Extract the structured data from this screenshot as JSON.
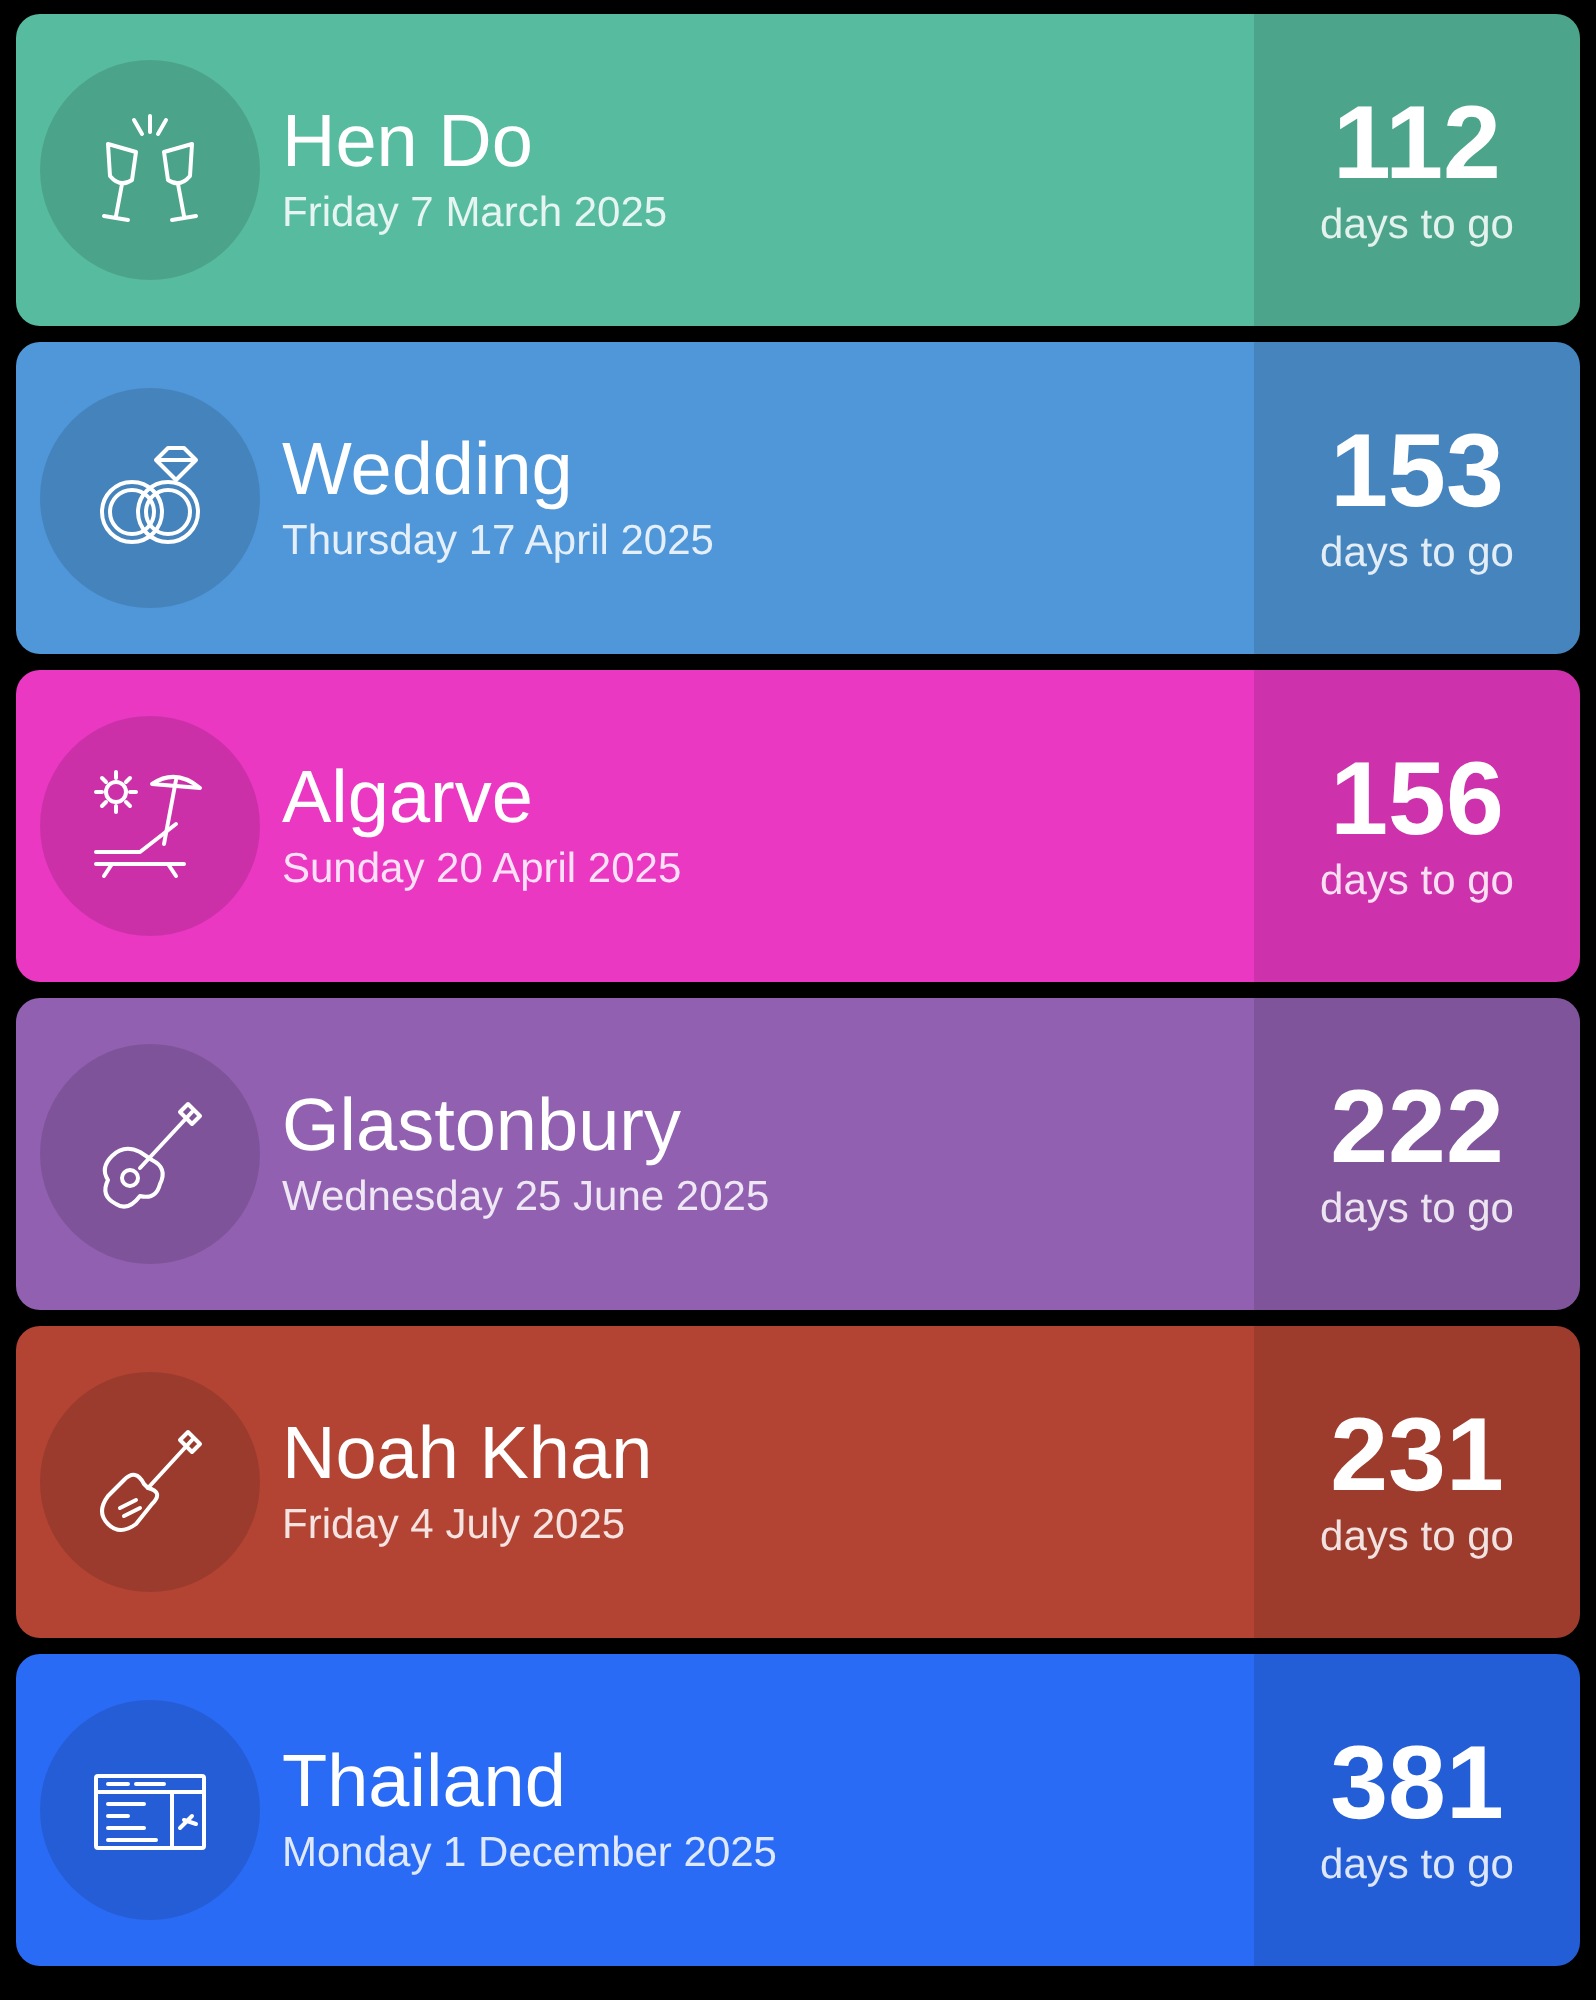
{
  "events": [
    {
      "title": "Hen Do",
      "date": "Friday 7 March 2025",
      "count": "112",
      "unit": "days to go",
      "color": "#57bc9f"
    },
    {
      "title": "Wedding",
      "date": "Thursday 17 April 2025",
      "count": "153",
      "unit": "days to go",
      "color": "#4f97d8"
    },
    {
      "title": "Algarve",
      "date": "Sunday 20 April 2025",
      "count": "156",
      "unit": "days to go",
      "color": "#ea38c3"
    },
    {
      "title": "Glastonbury",
      "date": "Wednesday 25 June 2025",
      "count": "222",
      "unit": "days to go",
      "color": "#9160b1"
    },
    {
      "title": "Noah Khan",
      "date": "Friday 4 July 2025",
      "count": "231",
      "unit": "days to go",
      "color": "#b34434"
    },
    {
      "title": "Thailand",
      "date": "Monday 1 December 2025",
      "count": "381",
      "unit": "days to go",
      "color": "#2a6bf5"
    }
  ]
}
